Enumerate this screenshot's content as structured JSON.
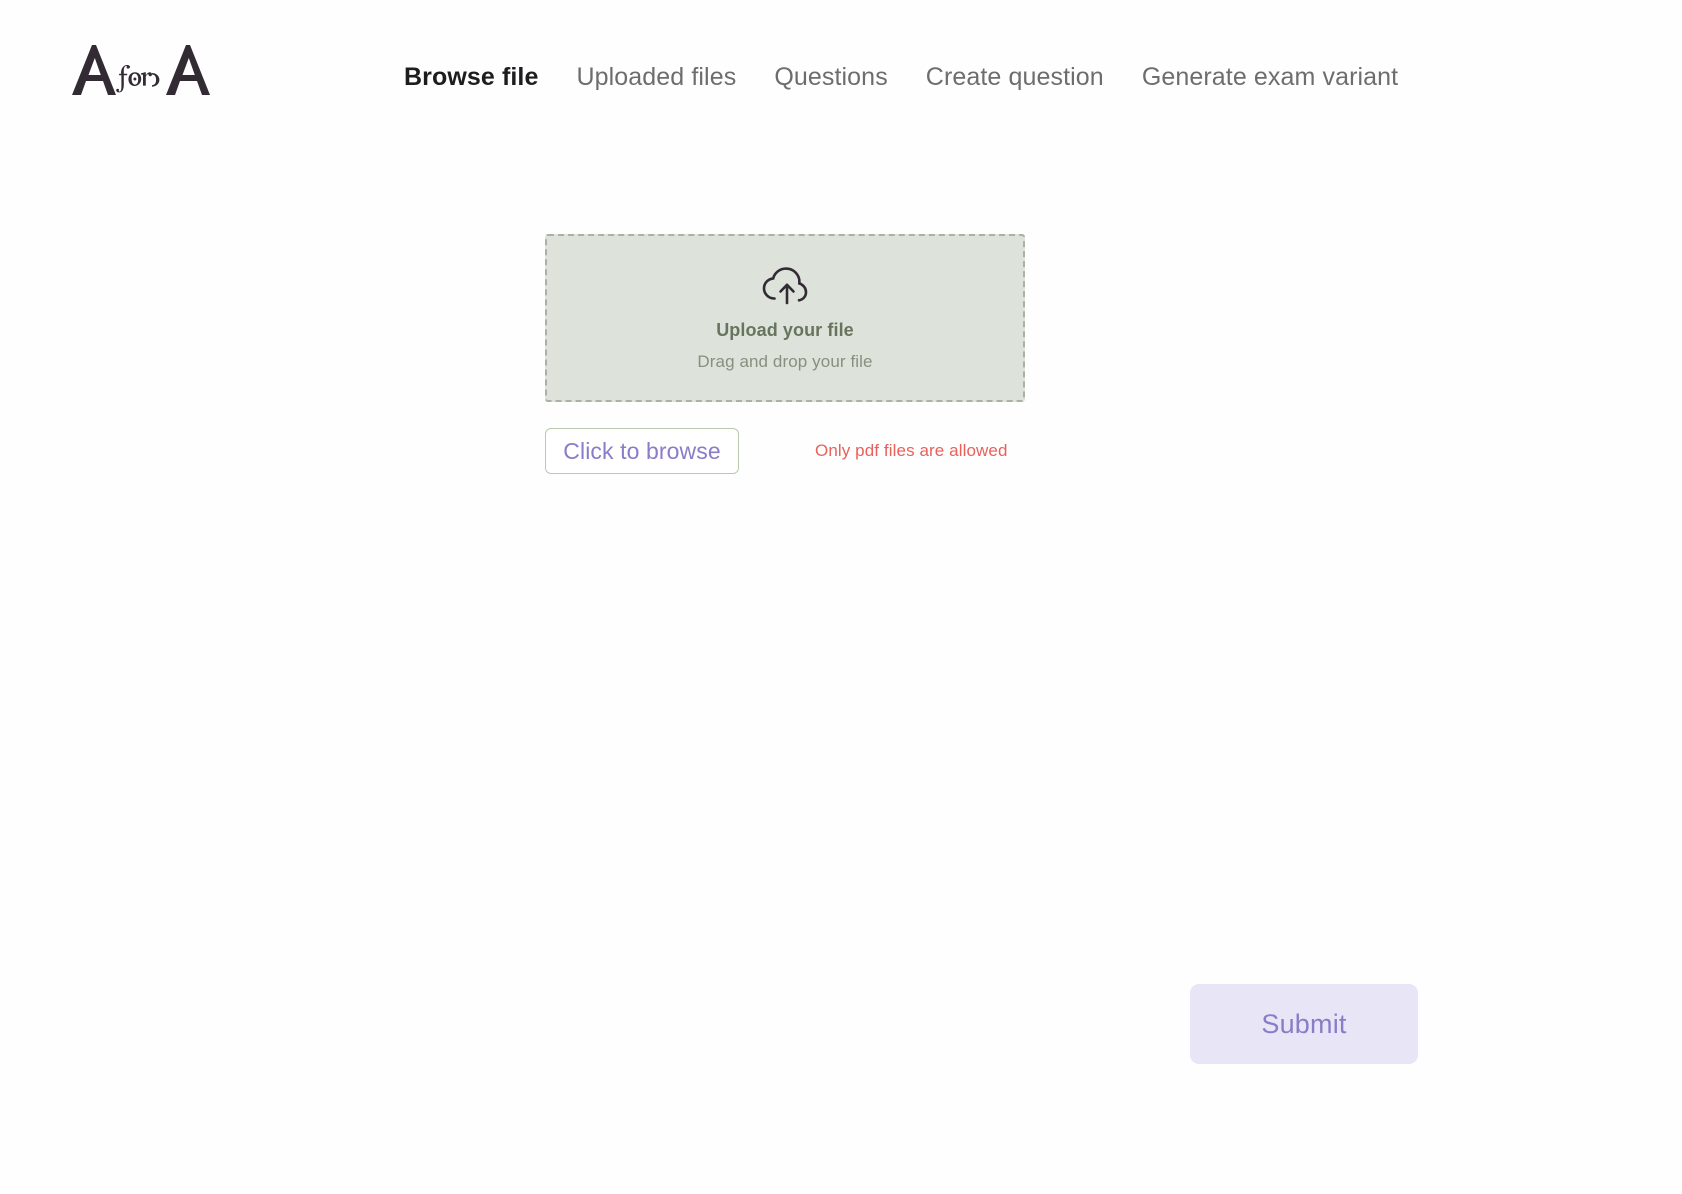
{
  "brand": {
    "logo_text": "A for A",
    "logo_icon": "a-for-a-logo"
  },
  "nav": {
    "items": [
      {
        "label": "Browse file",
        "active": true
      },
      {
        "label": "Uploaded files",
        "active": false
      },
      {
        "label": "Questions",
        "active": false
      },
      {
        "label": "Create question",
        "active": false
      },
      {
        "label": "Generate exam variant",
        "active": false
      }
    ]
  },
  "upload": {
    "icon": "cloud-upload-icon",
    "title": "Upload your file",
    "subtitle": "Drag and drop your file",
    "browse_label": "Click to browse",
    "error_message": "Only pdf files are allowed"
  },
  "footer": {
    "submit_label": "Submit"
  },
  "colors": {
    "dropzone_bg": "#dde3da",
    "dropzone_border": "#a9b0a5",
    "accent_purple": "#8b7cc8",
    "submit_bg": "#e8e5f7",
    "error_red": "#e8615c",
    "title_green": "#68745e",
    "nav_inactive": "#6f6c70",
    "nav_active": "#1d1c1f"
  }
}
